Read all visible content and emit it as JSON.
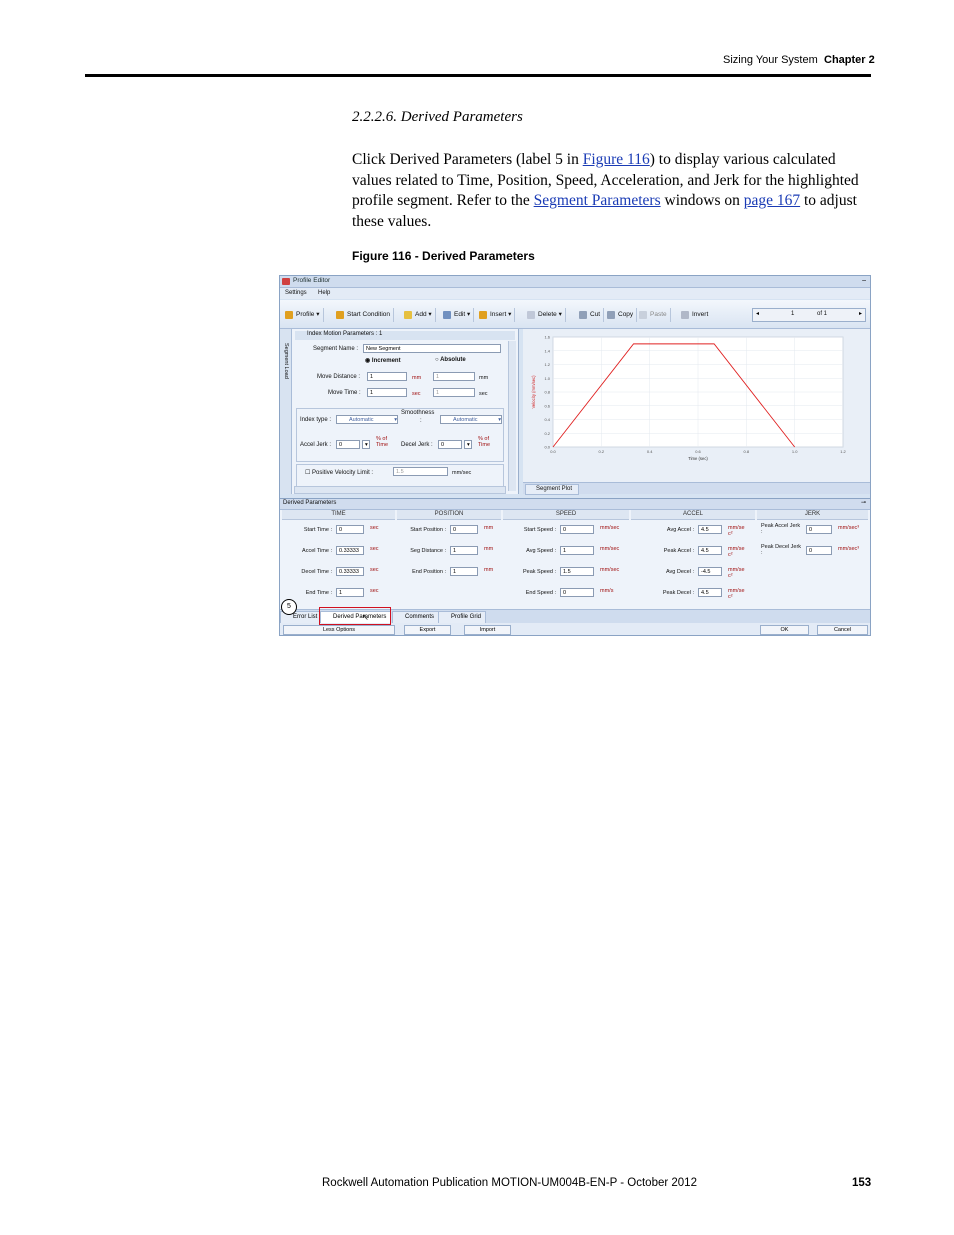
{
  "header": {
    "section": "Sizing Your System",
    "chapter": "Chapter 2"
  },
  "section_title": "2.2.2.6.   Derived Parameters",
  "body": {
    "t1": "Click Derived Parameters (label 5 in ",
    "link1": "Figure 116",
    "t2": ") to display various calculated values related to Time, Position, Speed, Acceleration, and Jerk for the highlighted profile segment. Refer to the ",
    "link2": "Segment Parameters",
    "t3": " windows on ",
    "link3": "page 167",
    "t4": " to adjust these values."
  },
  "figure_caption": "Figure 116 - Derived Parameters",
  "footer": {
    "publication": "Rockwell Automation Publication MOTION-UM004B-EN-P - October 2012",
    "page": "153"
  },
  "screenshot": {
    "window_title": "Profile Editor",
    "menu": [
      "Settings",
      "Help"
    ],
    "toolbar": [
      "Profile",
      "Start Condition",
      "Add",
      "Edit",
      "Insert",
      "Delete",
      "Cut",
      "Copy",
      "Paste",
      "Invert"
    ],
    "page": {
      "current": "1",
      "of": "of 1"
    },
    "colors": {
      "accent_red": "#d01020",
      "plot_line": "#e02020"
    },
    "left_panel": {
      "vertical_tab": "Segment Load",
      "title": "Index Motion Parameters : 1",
      "segment_name_label": "Segment Name :",
      "segment_name_value": "New Segment",
      "increment": "Increment",
      "absolute": "Absolute",
      "move_distance_label": "Move Distance :",
      "move_distance_value": "1",
      "move_distance_unit": "mm",
      "move_distance_value2": "1",
      "move_distance_unit2": "mm",
      "move_time_label": "Move Time :",
      "move_time_value": "1",
      "move_time_unit": "sec",
      "move_time_value2": "1",
      "move_time_unit2": "sec",
      "index_type_label": "Index type :",
      "index_type_value": "Automatic",
      "smoothness_label": "Smoothness",
      "smoothness_colon": ":",
      "smoothness_value": "Automatic",
      "accel_jerk_label": "Accel Jerk :",
      "accel_jerk_value": "0",
      "decel_jerk_label": "Decel Jerk :",
      "decel_jerk_value": "0",
      "pct_of_time": "% of Time",
      "pos_vel_limit_label": "Positive Velocity Limit :",
      "pos_vel_limit_value": "1.5",
      "pos_vel_limit_unit": "mm/sec"
    },
    "plot_tab": "Segment Plot",
    "chart_data": {
      "type": "line",
      "xlabel": "Time (sec)",
      "ylabel": "Velocity (mm/sec)",
      "xlim": [
        0,
        1.2
      ],
      "ylim": [
        0,
        1.6
      ],
      "x_ticks": [
        "0.0",
        "0.2",
        "0.4",
        "0.6",
        "0.8",
        "1.0",
        "1.2"
      ],
      "y_ticks": [
        "0.0",
        "0.2",
        "0.4",
        "0.6",
        "0.8",
        "1.0",
        "1.2",
        "1.4",
        "1.6"
      ],
      "grid": true,
      "x": [
        0,
        0.3333,
        0.6667,
        1.0
      ],
      "y": [
        0,
        1.5,
        1.5,
        0
      ]
    },
    "derived": {
      "title": "Derived Parameters",
      "columns": [
        "TIME",
        "POSITION",
        "SPEED",
        "ACCEL",
        "JERK"
      ],
      "time": [
        {
          "label": "Start Time :",
          "value": "0",
          "unit": "sec"
        },
        {
          "label": "Accel Time :",
          "value": "0.33333",
          "unit": "sec"
        },
        {
          "label": "Decel Time :",
          "value": "0.33333",
          "unit": "sec"
        },
        {
          "label": "End Time :",
          "value": "1",
          "unit": "sec"
        }
      ],
      "position": [
        {
          "label": "Start Position :",
          "value": "0",
          "unit": "mm"
        },
        {
          "label": "Seg Distance :",
          "value": "1",
          "unit": "mm"
        },
        {
          "label": "End Position :",
          "value": "1",
          "unit": "mm"
        }
      ],
      "speed": [
        {
          "label": "Start Speed :",
          "value": "0",
          "unit": "mm/sec"
        },
        {
          "label": "Avg Speed :",
          "value": "1",
          "unit": "mm/sec"
        },
        {
          "label": "Peak Speed :",
          "value": "1.5",
          "unit": "mm/sec"
        },
        {
          "label": "End Speed :",
          "value": "0",
          "unit": "mm/s"
        }
      ],
      "accel": [
        {
          "label": "Avg Accel :",
          "value": "4.5",
          "unit": "mm/se c²"
        },
        {
          "label": "Peak Accel :",
          "value": "4.5",
          "unit": "mm/se c²"
        },
        {
          "label": "Avg Decel :",
          "value": "-4.5",
          "unit": "mm/se c²"
        },
        {
          "label": "Peak Decel :",
          "value": "4.5",
          "unit": "mm/se c²"
        }
      ],
      "jerk": [
        {
          "label": "Peak Accel Jerk :",
          "value": "0",
          "unit": "mm/sec³"
        },
        {
          "label": "Peak Decel Jerk :",
          "value": "0",
          "unit": "mm/sec³"
        }
      ]
    },
    "bottom_tabs": [
      "Error List",
      "Derived Parameters",
      "Comments",
      "Profile Grid"
    ],
    "buttons": [
      "Less Options",
      "Export",
      "Import",
      "OK",
      "Cancel"
    ],
    "callout": "5"
  }
}
